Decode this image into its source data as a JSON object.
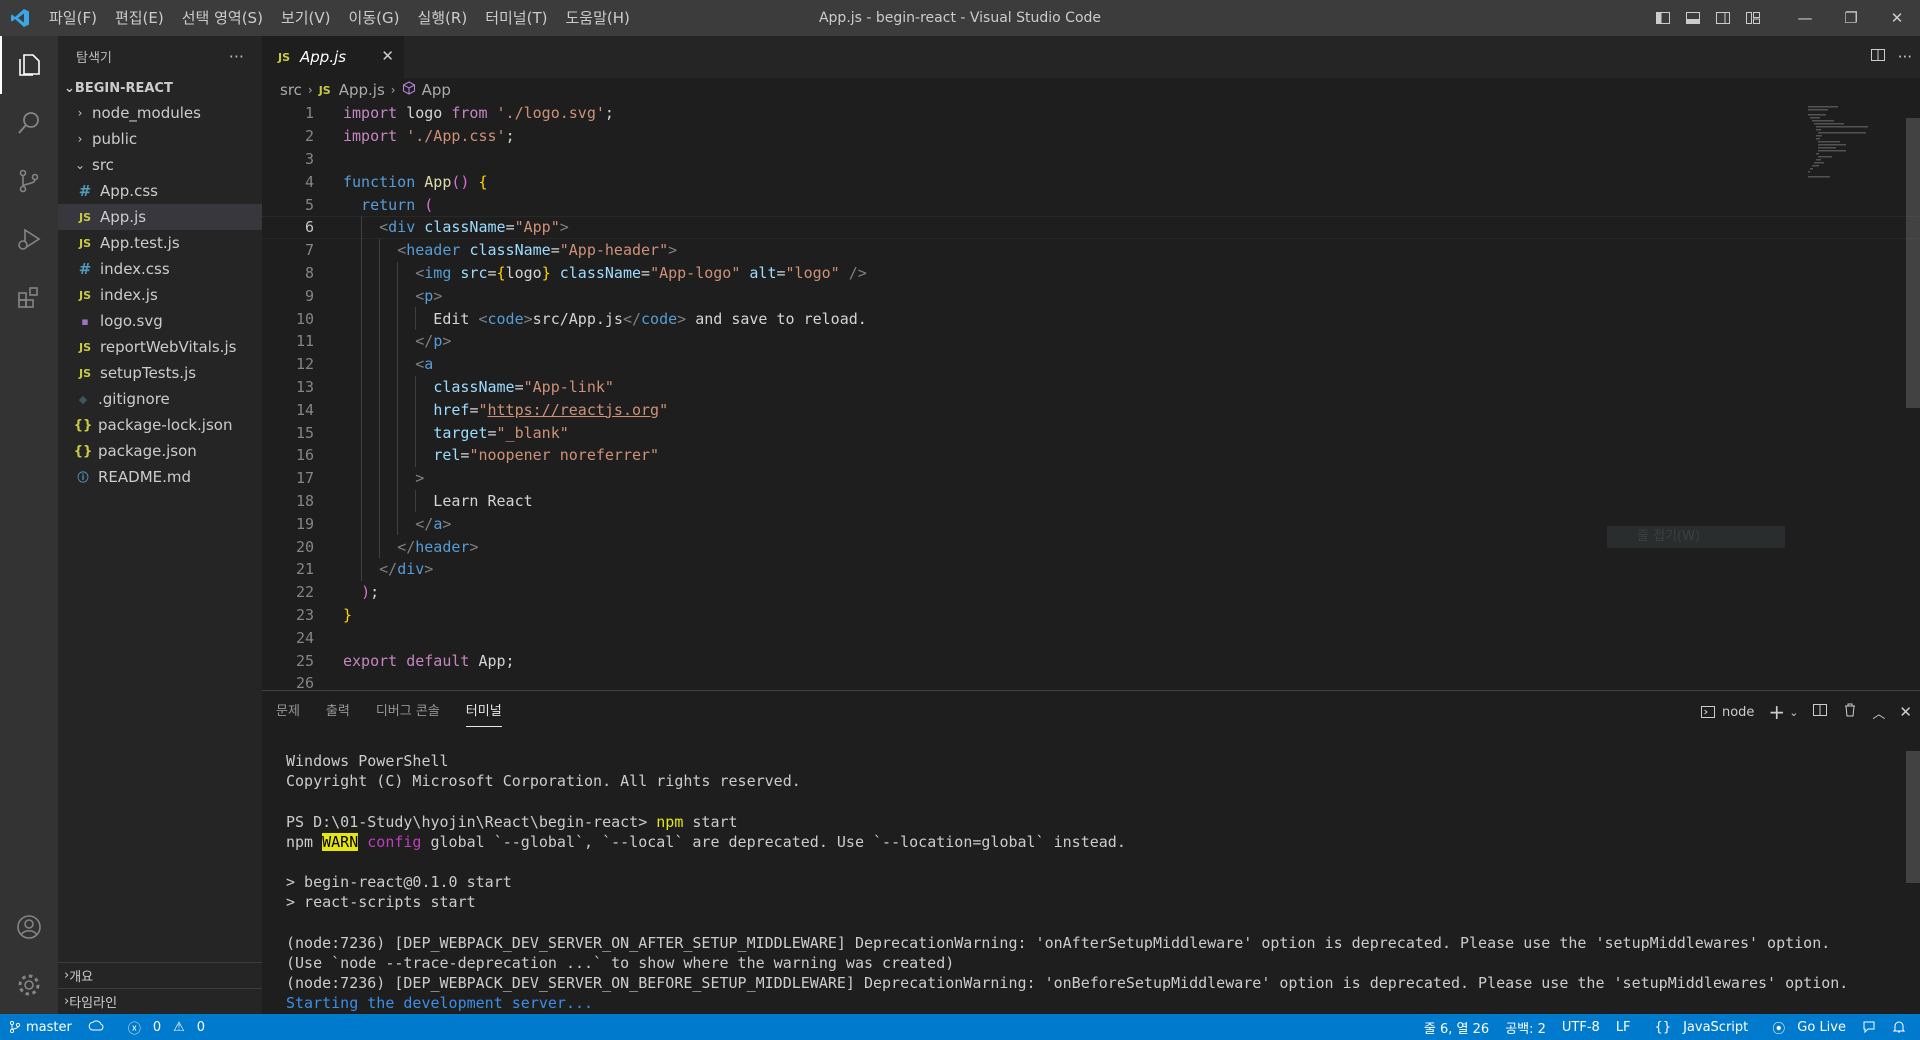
{
  "titlebar": {
    "menu": [
      "파일(F)",
      "편집(E)",
      "선택 영역(S)",
      "보기(V)",
      "이동(G)",
      "실행(R)",
      "터미널(T)",
      "도움말(H)"
    ],
    "title": "App.js - begin-react - Visual Studio Code",
    "window": {
      "minimize": "—",
      "restore": "❐",
      "close": "✕"
    }
  },
  "sidebar": {
    "header": "탐색기",
    "more": "···",
    "project": "BEGIN-REACT",
    "tree": [
      {
        "label": "node_modules",
        "type": "folder",
        "expanded": false,
        "depth": 1
      },
      {
        "label": "public",
        "type": "folder",
        "expanded": false,
        "depth": 1
      },
      {
        "label": "src",
        "type": "folder",
        "expanded": true,
        "depth": 1
      },
      {
        "label": "App.css",
        "type": "css",
        "depth": 2
      },
      {
        "label": "App.js",
        "type": "js",
        "depth": 2,
        "selected": true
      },
      {
        "label": "App.test.js",
        "type": "js",
        "depth": 2
      },
      {
        "label": "index.css",
        "type": "css",
        "depth": 2
      },
      {
        "label": "index.js",
        "type": "js",
        "depth": 2
      },
      {
        "label": "logo.svg",
        "type": "svg",
        "depth": 2
      },
      {
        "label": "reportWebVitals.js",
        "type": "js",
        "depth": 2
      },
      {
        "label": "setupTests.js",
        "type": "js",
        "depth": 2
      },
      {
        "label": ".gitignore",
        "type": "git",
        "depth": 1
      },
      {
        "label": "package-lock.json",
        "type": "json",
        "depth": 1
      },
      {
        "label": "package.json",
        "type": "json",
        "depth": 1
      },
      {
        "label": "README.md",
        "type": "md",
        "depth": 1
      }
    ],
    "outline": "개요",
    "timeline": "타임라인"
  },
  "editor": {
    "tab": {
      "badge": "JS",
      "label": "App.js",
      "close": "✕"
    },
    "breadcrumb": {
      "folder": "src",
      "file": "App.js",
      "symbol": "App"
    },
    "current_line": 6,
    "lines": [
      "import logo from './logo.svg';",
      "import './App.css';",
      "",
      "function App() {",
      "  return (",
      "    <div className=\"App\">",
      "      <header className=\"App-header\">",
      "        <img src={logo} className=\"App-logo\" alt=\"logo\" />",
      "        <p>",
      "          Edit <code>src/App.js</code> and save to reload.",
      "        </p>",
      "        <a",
      "          className=\"App-link\"",
      "          href=\"https://reactjs.org\"",
      "          target=\"_blank\"",
      "          rel=\"noopener noreferrer\"",
      "        >",
      "          Learn React",
      "        </a>",
      "      </header>",
      "    </div>",
      "  );",
      "}",
      "",
      "export default App;",
      ""
    ],
    "hover_ghost": "줄 접기(W)"
  },
  "panel": {
    "tabs": [
      "문제",
      "출력",
      "디버그 콘솔",
      "터미널"
    ],
    "active_tab": 3,
    "terminal_name": "node",
    "terminal_lines": [
      "Windows PowerShell",
      "Copyright (C) Microsoft Corporation. All rights reserved.",
      "",
      "PS D:\\01-Study\\hyojin\\React\\begin-react> npm start",
      "npm WARN config global `--global`, `--local` are deprecated. Use `--location=global` instead.",
      "",
      "> begin-react@0.1.0 start",
      "> react-scripts start",
      "",
      "(node:7236) [DEP_WEBPACK_DEV_SERVER_ON_AFTER_SETUP_MIDDLEWARE] DeprecationWarning: 'onAfterSetupMiddleware' option is deprecated. Please use the 'setupMiddlewares' option.",
      "(Use `node --trace-deprecation ...` to show where the warning was created)",
      "(node:7236) [DEP_WEBPACK_DEV_SERVER_ON_BEFORE_SETUP_MIDDLEWARE] DeprecationWarning: 'onBeforeSetupMiddleware' option is deprecated. Please use the 'setupMiddlewares' option.",
      "Starting the development server..."
    ]
  },
  "statusbar": {
    "branch": "master",
    "errors": "0",
    "warnings": "0",
    "position": "줄 6, 열 26",
    "spaces": "공백: 2",
    "encoding": "UTF-8",
    "eol": "LF",
    "language": "JavaScript",
    "golive": "Go Live"
  },
  "colors": {
    "statusbar": "#007acc",
    "titlebar": "#3c3c3c",
    "activitybar": "#333333",
    "sidebar": "#252526",
    "editor": "#1e1e1e"
  }
}
